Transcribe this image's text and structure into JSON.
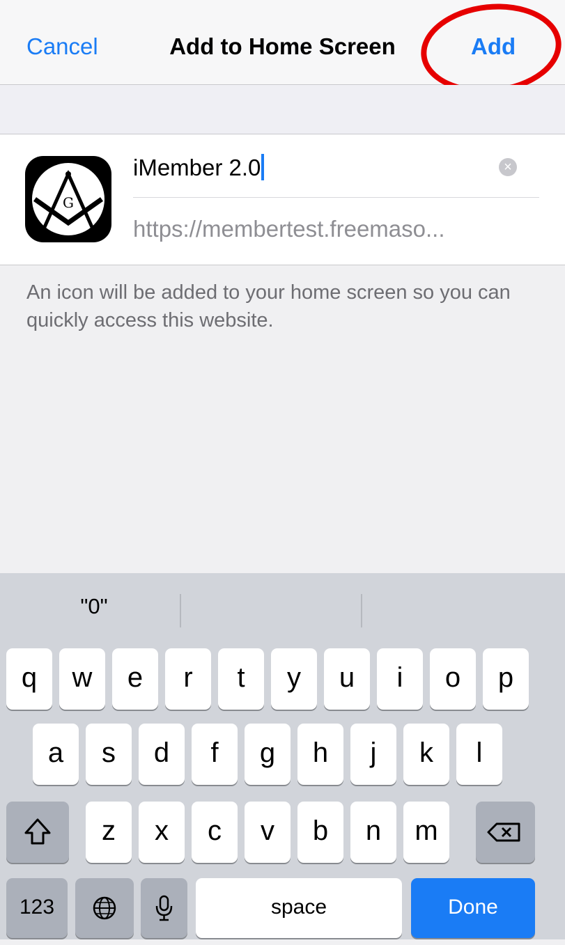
{
  "navbar": {
    "cancel_label": "Cancel",
    "title": "Add to Home Screen",
    "add_label": "Add"
  },
  "form": {
    "name_value": "iMember 2.0",
    "url_value": "https://membertest.freemaso...",
    "icon_letter": "G"
  },
  "help_text": "An icon will be added to your home screen so you can quickly access this website.",
  "keyboard": {
    "predictions": [
      "\"0\"",
      "",
      ""
    ],
    "row1": [
      "q",
      "w",
      "e",
      "r",
      "t",
      "y",
      "u",
      "i",
      "o",
      "p"
    ],
    "row2": [
      "a",
      "s",
      "d",
      "f",
      "g",
      "h",
      "j",
      "k",
      "l"
    ],
    "row3": [
      "z",
      "x",
      "c",
      "v",
      "b",
      "n",
      "m"
    ],
    "shift_icon": "shift-icon",
    "delete_icon": "delete-backspace-icon",
    "numbers_label": "123",
    "globe_icon": "globe-icon",
    "mic_icon": "microphone-icon",
    "space_label": "space",
    "done_label": "Done"
  },
  "colors": {
    "accent": "#1a7cf5",
    "highlight": "#e60000",
    "keyboard_bg": "#d1d4da"
  }
}
